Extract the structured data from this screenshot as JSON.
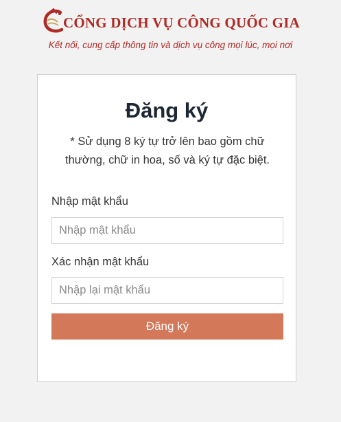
{
  "header": {
    "title": "CỔNG DỊCH VỤ CÔNG QUỐC GIA",
    "tagline": "Kết nối, cung cấp thông tin và dịch vụ công mọi lúc, mọi nơi"
  },
  "form": {
    "title": "Đăng ký",
    "hint": "* Sử dụng 8 ký tự trở lên bao gồm chữ thường, chữ in hoa, số và ký tự đặc biệt.",
    "password": {
      "label": "Nhập mật khẩu",
      "placeholder": "Nhập mật khẩu",
      "value": ""
    },
    "confirm_password": {
      "label": "Xác nhận mật khẩu",
      "placeholder": "Nhập lại mật khẩu",
      "value": ""
    },
    "submit_label": "Đăng ký"
  },
  "colors": {
    "brand": "#b02a25",
    "button": "#d4785a",
    "background": "#f2f2f2",
    "title_text": "#1d2733"
  },
  "icons": {
    "logo": "national-public-service-portal-logo"
  }
}
